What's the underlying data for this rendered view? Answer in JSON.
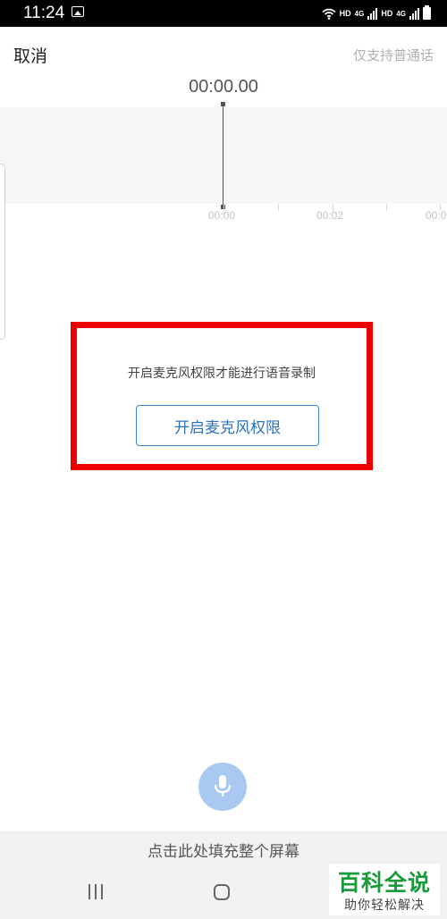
{
  "status_bar": {
    "time": "11:24",
    "network_labels": [
      "HD",
      "4G",
      "HD",
      "4G"
    ]
  },
  "header": {
    "cancel_label": "取消",
    "notice": "仅支持普通话"
  },
  "recorder": {
    "timer": "00:00.00",
    "timeline_labels": [
      "00:00",
      "00:02",
      "00:0"
    ]
  },
  "permission": {
    "message": "开启麦克风权限才能进行语音录制",
    "button_label": "开启麦克风权限"
  },
  "mic": {
    "icon": "microphone-icon",
    "color": "#a9c9f3"
  },
  "fill_screen": {
    "label": "点击此处填充整个屏幕"
  },
  "navigation": {
    "icons": [
      "recent-apps-icon",
      "home-icon"
    ]
  },
  "watermark": {
    "title": "百科全说",
    "subtitle": "助你轻松解决"
  },
  "colors": {
    "highlight_border": "#ee0000",
    "accent": "#2e73b8",
    "watermark_green": "#1a9b3a"
  }
}
